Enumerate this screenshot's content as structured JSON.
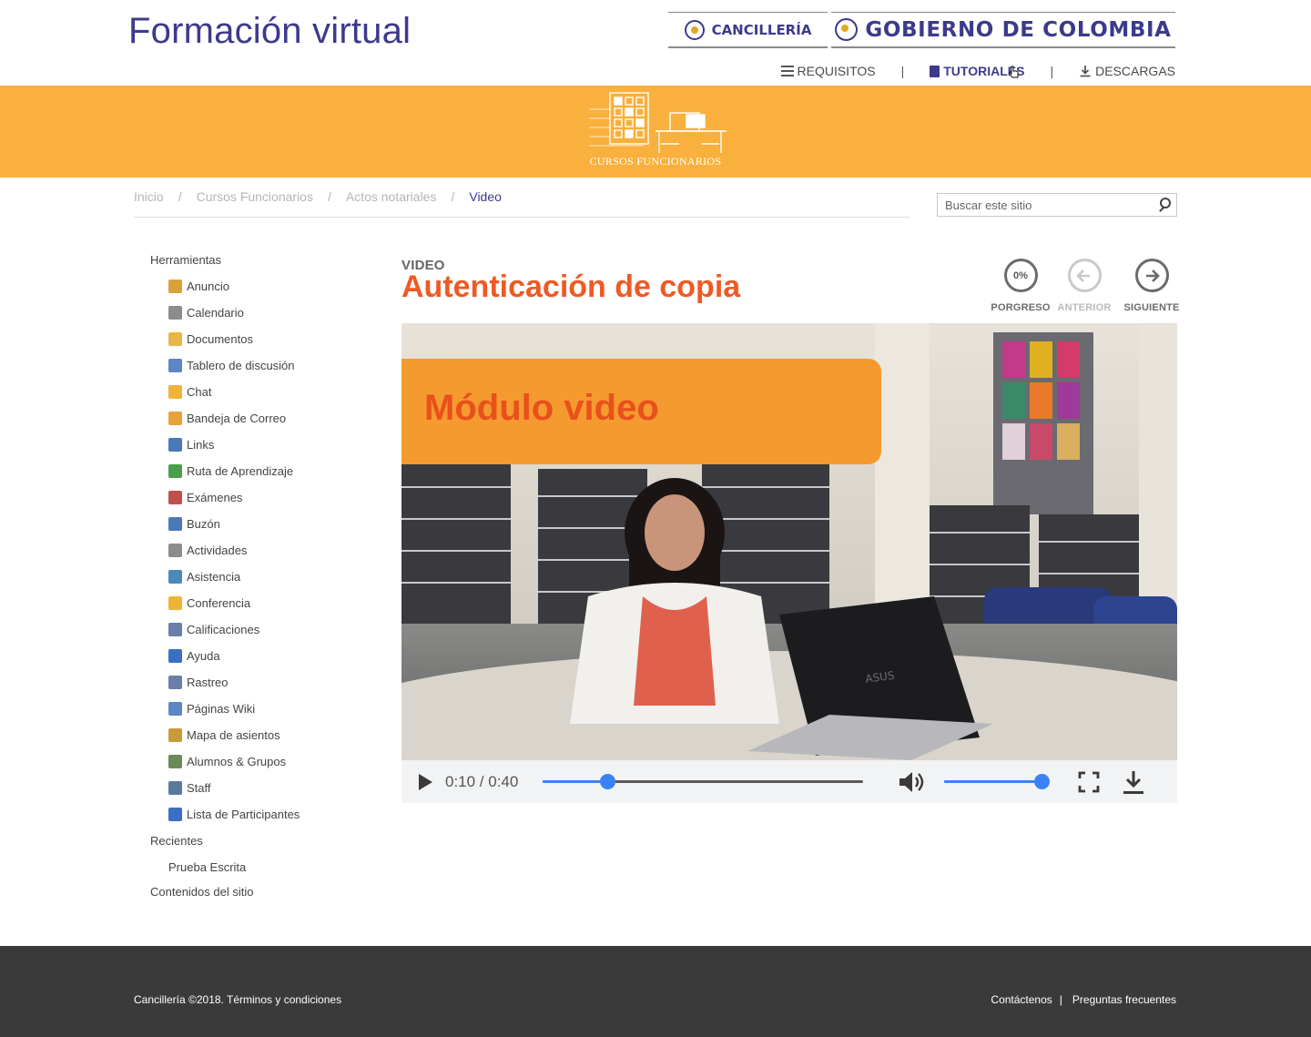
{
  "header": {
    "site_title": "Formación virtual",
    "brand_cancilleria": "CANCILLERÍA",
    "brand_gobierno": "GOBIERNO DE COLOMBIA",
    "nav": [
      {
        "label": "REQUISITOS",
        "icon": "list-icon"
      },
      {
        "label": "TUTORIALES",
        "icon": "book-icon",
        "active": true
      },
      {
        "label": "DESCARGAS",
        "icon": "download-icon"
      }
    ],
    "nav_separator": "|"
  },
  "banner": {
    "logo_text": "CURSOS FUNCIONARIOS",
    "color": "#f9b03c"
  },
  "breadcrumb": {
    "items": [
      "Inicio",
      "Cursos Funcionarios",
      "Actos notariales"
    ],
    "current": "Video",
    "separator": "/"
  },
  "search": {
    "placeholder": "Buscar este sitio"
  },
  "sidebar": {
    "tools_heading": "Herramientas",
    "tools": [
      {
        "label": "Anuncio",
        "icon": "megaphone-icon",
        "color": "#d9a13a"
      },
      {
        "label": "Calendario",
        "icon": "calendar-icon",
        "color": "#8c8c8c"
      },
      {
        "label": "Documentos",
        "icon": "documents-icon",
        "color": "#e8b54a"
      },
      {
        "label": "Tablero de discusión",
        "icon": "discussion-icon",
        "color": "#5c86c4"
      },
      {
        "label": "Chat",
        "icon": "chat-icon",
        "color": "#f0b33a"
      },
      {
        "label": "Bandeja de Correo",
        "icon": "mailbox-icon",
        "color": "#e8a23a"
      },
      {
        "label": "Links",
        "icon": "link-icon",
        "color": "#4a78b8"
      },
      {
        "label": "Ruta de Aprendizaje",
        "icon": "learning-path-icon",
        "color": "#4aa04a"
      },
      {
        "label": "Exámenes",
        "icon": "exam-icon",
        "color": "#c0504d"
      },
      {
        "label": "Buzón",
        "icon": "inbox-icon",
        "color": "#4a78b8"
      },
      {
        "label": "Actividades",
        "icon": "activities-icon",
        "color": "#8c8c8c"
      },
      {
        "label": "Asistencia",
        "icon": "attendance-icon",
        "color": "#4a8ab8"
      },
      {
        "label": "Conferencia",
        "icon": "conference-icon",
        "color": "#f0b33a"
      },
      {
        "label": "Calificaciones",
        "icon": "grades-icon",
        "color": "#6a7fa8"
      },
      {
        "label": "Ayuda",
        "icon": "help-icon",
        "color": "#3a6fc4"
      },
      {
        "label": "Rastreo",
        "icon": "tracking-icon",
        "color": "#6a7fa8"
      },
      {
        "label": "Páginas Wiki",
        "icon": "wiki-icon",
        "color": "#5c86c4"
      },
      {
        "label": "Mapa de asientos",
        "icon": "seating-map-icon",
        "color": "#c89a3a"
      },
      {
        "label": "Alumnos & Grupos",
        "icon": "students-groups-icon",
        "color": "#6a8a5a"
      },
      {
        "label": "Staff",
        "icon": "staff-icon",
        "color": "#5a7a9a"
      },
      {
        "label": "Lista de Participantes",
        "icon": "participants-icon",
        "color": "#3a6fc4"
      }
    ],
    "recent_heading": "Recientes",
    "recent": [
      "Prueba Escrita"
    ],
    "site_contents": "Contenidos del sitio"
  },
  "main": {
    "kicker": "VIDEO",
    "title": "Autenticación de copia",
    "controls": {
      "progress_value": "0%",
      "progress_label": "PORGRESO",
      "prev_label": "ANTERIOR",
      "next_label": "SIGUIENTE"
    },
    "video": {
      "overlay_title": "Módulo video",
      "current_time": "0:10",
      "duration": "0:40",
      "time_display": "0:10 / 0:40",
      "position_fraction": 0.2,
      "volume_fraction": 1.0,
      "accent": "#3b82f6"
    }
  },
  "footer": {
    "copyright": "Cancillería ©2018. Términos y condiciones",
    "links": [
      "Contáctenos",
      "Preguntas frecuentes"
    ],
    "link_separator": "|",
    "background": "#3a3a3a"
  }
}
